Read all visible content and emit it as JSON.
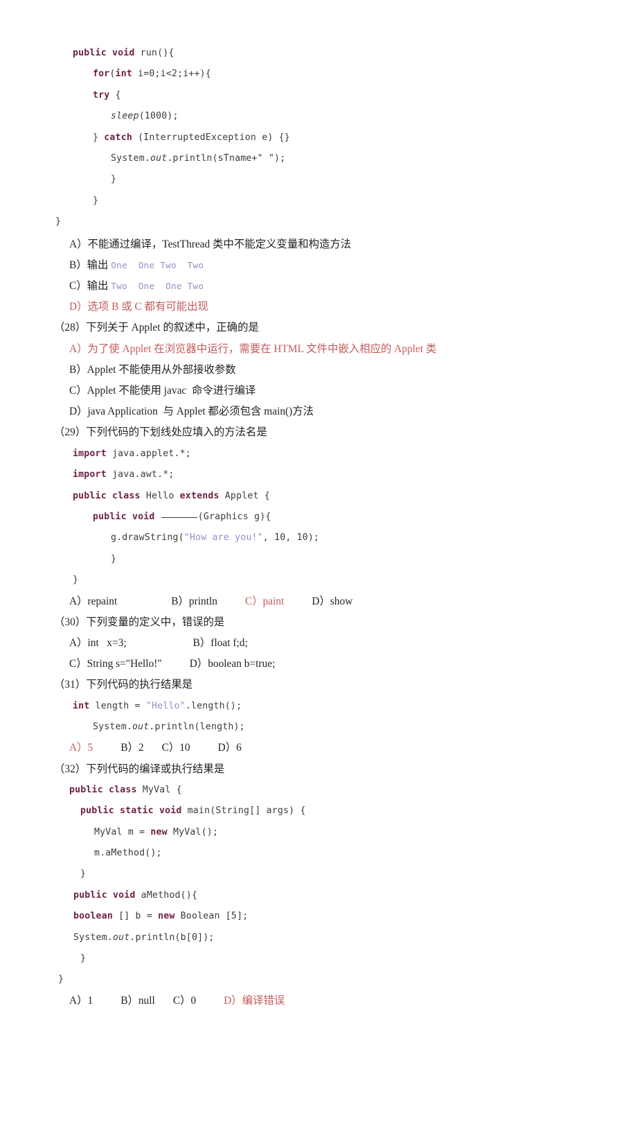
{
  "document": {
    "type": "exam-paper",
    "language": "zh-CN",
    "colors": {
      "keyword": "#6e1f47",
      "string": "#8f90c4",
      "answer_highlight": "#c35b5b",
      "body_text": "#231f20",
      "code_text": "#3d3a3c",
      "page_background": "#ffffff"
    }
  },
  "code_block_27": {
    "lines": [
      {
        "indent": 1,
        "segments": [
          {
            "t": "kw",
            "v": "public void"
          },
          {
            "t": "plain",
            "v": " run(){"
          }
        ]
      },
      {
        "indent": 2,
        "segments": [
          {
            "t": "kw",
            "v": "for"
          },
          {
            "t": "plain",
            "v": "("
          },
          {
            "t": "kw",
            "v": "int"
          },
          {
            "t": "plain",
            "v": " i=0;i<2;i++){"
          }
        ]
      },
      {
        "indent": 2,
        "segments": [
          {
            "t": "kw",
            "v": "try"
          },
          {
            "t": "plain",
            "v": " {"
          }
        ]
      },
      {
        "indent": 3,
        "segments": [
          {
            "t": "ital",
            "v": "sleep"
          },
          {
            "t": "plain",
            "v": "(1000);"
          }
        ]
      },
      {
        "indent": 2,
        "segments": [
          {
            "t": "plain",
            "v": "} "
          },
          {
            "t": "kw",
            "v": "catch"
          },
          {
            "t": "plain",
            "v": " (InterruptedException e) {}"
          }
        ]
      },
      {
        "indent": 3,
        "segments": [
          {
            "t": "plain",
            "v": "System."
          },
          {
            "t": "ital",
            "v": "out"
          },
          {
            "t": "plain",
            "v": ".println(sTname+\" \");"
          }
        ]
      },
      {
        "indent": 3,
        "segments": [
          {
            "t": "plain",
            "v": "}"
          }
        ]
      },
      {
        "indent": 2,
        "segments": [
          {
            "t": "plain",
            "v": "}"
          }
        ]
      },
      {
        "indent": 0,
        "segments": [
          {
            "t": "plain",
            "v": "}"
          }
        ]
      }
    ]
  },
  "question_27_options": {
    "a_label": "A）不能通过编译，TestThread 类中不能定义变量和构造方法",
    "b_prefix": "B）输出 ",
    "b_code": "One  One Two  Two",
    "c_prefix": "C）输出 ",
    "c_code": "Two  One  One Two",
    "d_label": "D）选项 B 或 C 都有可能出现",
    "d_is_answer": true
  },
  "question_28": {
    "number": "（28）",
    "stem": "下列关于 Applet 的叙述中，正确的是",
    "options": [
      {
        "label": "A）为了使 Applet 在浏览器中运行，需要在 HTML 文件中嵌入相应的 Applet 类",
        "is_answer": true
      },
      {
        "label": "B）Applet 不能使用从外部接收参数",
        "is_answer": false
      },
      {
        "label": "C）Applet 不能使用 javac  命令进行编译",
        "is_answer": false
      },
      {
        "label": "D）java Application  与 Applet 都必须包含 main()方法",
        "is_answer": false
      }
    ]
  },
  "question_29": {
    "number": "（29）",
    "stem": "下列代码的下划线处应填入的方法名是",
    "code_lines": [
      {
        "indent": 1,
        "segments": [
          {
            "t": "kw",
            "v": "import"
          },
          {
            "t": "plain",
            "v": " java.applet.*;"
          }
        ]
      },
      {
        "indent": 1,
        "segments": [
          {
            "t": "kw",
            "v": "import"
          },
          {
            "t": "plain",
            "v": " java.awt.*;"
          }
        ]
      },
      {
        "indent": 1,
        "segments": [
          {
            "t": "kw",
            "v": "public class"
          },
          {
            "t": "plain",
            "v": " Hello "
          },
          {
            "t": "kw",
            "v": "extends"
          },
          {
            "t": "plain",
            "v": " Applet {"
          }
        ]
      },
      {
        "indent": 2,
        "segments": [
          {
            "t": "kw",
            "v": "public void"
          },
          {
            "t": "plain",
            "v": " "
          },
          {
            "t": "blank",
            "v": ""
          },
          {
            "t": "plain",
            "v": "(Graphics g){"
          }
        ]
      },
      {
        "indent": 3,
        "segments": [
          {
            "t": "plain",
            "v": "g.drawString("
          },
          {
            "t": "str",
            "v": "\"How are you!\""
          },
          {
            "t": "plain",
            "v": ", 10, 10);"
          }
        ]
      },
      {
        "indent": 3,
        "segments": [
          {
            "t": "plain",
            "v": "}"
          }
        ]
      },
      {
        "indent": 1,
        "segments": [
          {
            "t": "plain",
            "v": "}"
          }
        ]
      }
    ],
    "answers": [
      {
        "label": "A）repaint",
        "is_answer": false
      },
      {
        "label": "B）println",
        "is_answer": false
      },
      {
        "label": "C）paint",
        "is_answer": true
      },
      {
        "label": "D）show",
        "is_answer": false
      }
    ]
  },
  "question_30": {
    "number": "（30）",
    "stem": "下列变量的定义中，错误的是",
    "row1_left": "A）int   x=3;",
    "row1_right": "B）float f;d;",
    "row2_left": "C）String s=\"Hello!\"",
    "row2_right": "D）boolean b=true;"
  },
  "question_31": {
    "number": "（31）",
    "stem": "下列代码的执行结果是",
    "code_lines": [
      {
        "indent": 1,
        "segments": [
          {
            "t": "kw",
            "v": "int"
          },
          {
            "t": "plain",
            "v": " length = "
          },
          {
            "t": "str",
            "v": "\"Hello\""
          },
          {
            "t": "plain",
            "v": ".length();"
          }
        ]
      },
      {
        "indent": 2,
        "segments": [
          {
            "t": "plain",
            "v": "System."
          },
          {
            "t": "ital",
            "v": "out"
          },
          {
            "t": "plain",
            "v": ".println(length);"
          }
        ]
      }
    ],
    "answers": [
      {
        "label": "A）5",
        "is_answer": true
      },
      {
        "label": "B）2",
        "is_answer": false
      },
      {
        "label": "C）10",
        "is_answer": false
      },
      {
        "label": "D）6",
        "is_answer": false
      }
    ]
  },
  "question_32": {
    "number": "（32）",
    "stem": "下列代码的编译或执行结果是",
    "code_lines": [
      {
        "indent": 0,
        "segments": [
          {
            "t": "kw",
            "v": "public class"
          },
          {
            "t": "plain",
            "v": " MyVal {"
          }
        ]
      },
      {
        "indent": 1,
        "segments": [
          {
            "t": "kw",
            "v": "public static void"
          },
          {
            "t": "plain",
            "v": " main(String[] args) {"
          }
        ]
      },
      {
        "indent": 2,
        "segments": [
          {
            "t": "plain",
            "v": "MyVal m = "
          },
          {
            "t": "kw",
            "v": "new"
          },
          {
            "t": "plain",
            "v": " MyVal();"
          }
        ]
      },
      {
        "indent": 2,
        "segments": [
          {
            "t": "plain",
            "v": "m.aMethod();"
          }
        ]
      },
      {
        "indent": 1,
        "segments": [
          {
            "t": "plain",
            "v": "}"
          }
        ]
      },
      {
        "indent": 0,
        "segments": [
          {
            "t": "kw",
            "v": "public void"
          },
          {
            "t": "plain",
            "v": " aMethod(){"
          }
        ]
      },
      {
        "indent": 0,
        "segments": [
          {
            "t": "kw",
            "v": "boolean"
          },
          {
            "t": "plain",
            "v": " [] b = "
          },
          {
            "t": "kw",
            "v": "new"
          },
          {
            "t": "plain",
            "v": " Boolean [5];"
          }
        ]
      },
      {
        "indent": 0,
        "segments": [
          {
            "t": "plain",
            "v": "System."
          },
          {
            "t": "ital",
            "v": "out"
          },
          {
            "t": "plain",
            "v": ".println(b[0]);"
          }
        ]
      },
      {
        "indent": 1,
        "segments": [
          {
            "t": "plain",
            "v": "}"
          }
        ]
      },
      {
        "indent": 0,
        "segments": [
          {
            "t": "plain",
            "v": "}"
          }
        ]
      }
    ],
    "answers": [
      {
        "label": "A）1",
        "is_answer": false
      },
      {
        "label": "B）null",
        "is_answer": false
      },
      {
        "label": "C）0",
        "is_answer": false
      },
      {
        "label": "D）编译错误",
        "is_answer": true
      }
    ]
  }
}
